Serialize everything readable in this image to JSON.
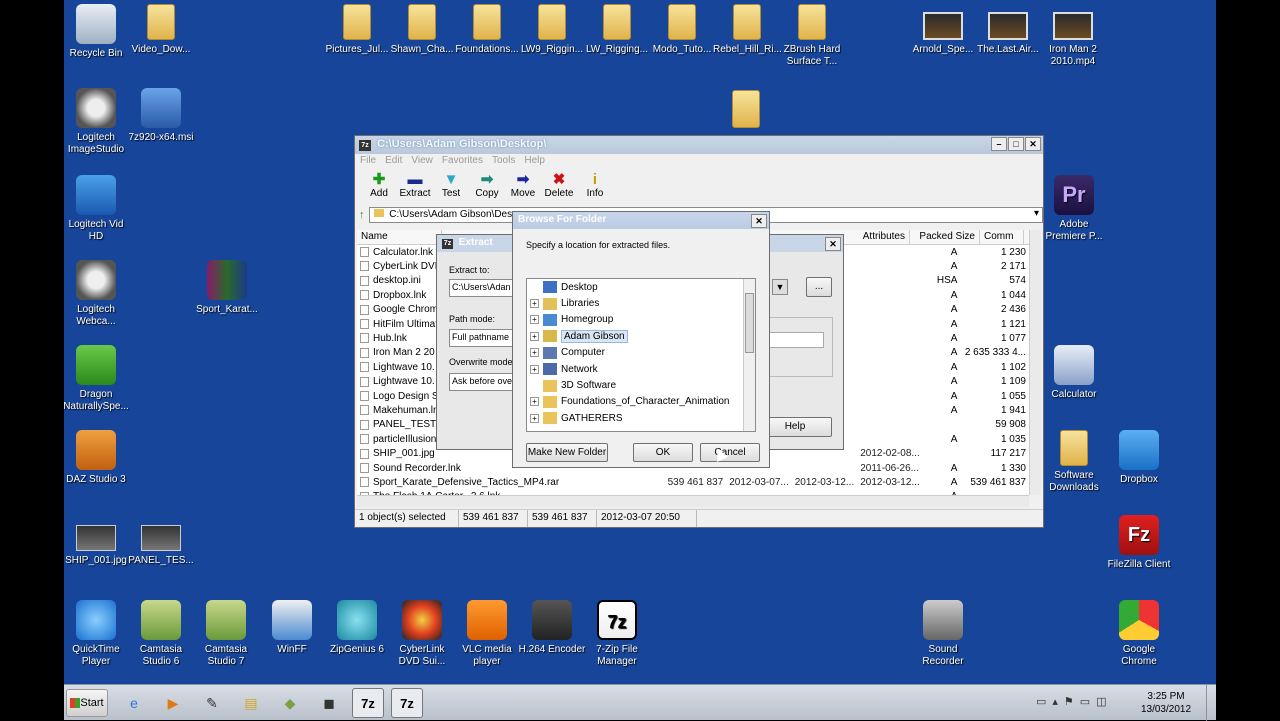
{
  "desktop": {
    "icons_top": [
      {
        "label": "Recycle Bin",
        "icon": "recycle-bin-icon"
      },
      {
        "label": "Video_Dow...",
        "icon": "folder-icon"
      },
      {
        "label": "Pictures_Jul...",
        "icon": "folder-icon"
      },
      {
        "label": "Shawn_Cha...",
        "icon": "folder-icon"
      },
      {
        "label": "Foundations...",
        "icon": "folder-icon"
      },
      {
        "label": "LW9_Riggin...",
        "icon": "folder-icon"
      },
      {
        "label": "LW_Rigging...",
        "icon": "folder-icon"
      },
      {
        "label": "Modo_Tuto...",
        "icon": "folder-icon"
      },
      {
        "label": "Rebel_Hill_Ri...",
        "icon": "folder-icon"
      },
      {
        "label": "ZBrush Hard Surface T...",
        "icon": "folder-icon"
      },
      {
        "label": "Arnold_Spe...",
        "icon": "video-icon"
      },
      {
        "label": "The.Last.Air...",
        "icon": "video-icon"
      },
      {
        "label": "Iron Man 2 2010.mp4",
        "icon": "video-icon"
      }
    ],
    "icons_left": [
      {
        "label": "Logitech ImageStudio",
        "icon": "webcam-icon"
      },
      {
        "label": "7z920-x64.msi",
        "icon": "installer-icon"
      },
      {
        "label": "Logitech Vid HD",
        "icon": "logitech-vid-icon"
      },
      {
        "label": "Logitech Webca...",
        "icon": "webcam-icon"
      },
      {
        "label": "Sport_Karat...",
        "icon": "rar-archive-icon"
      },
      {
        "label": "Dragon NaturallySpe...",
        "icon": "dragon-icon"
      },
      {
        "label": "DAZ Studio 3",
        "icon": "daz-studio-icon"
      },
      {
        "label": "SHIP_001.jpg",
        "icon": "image-file-icon"
      },
      {
        "label": "PANEL_TES...",
        "icon": "image-file-icon"
      }
    ],
    "icons_right": [
      {
        "label": "Adobe Premiere P...",
        "icon": "premiere-icon"
      },
      {
        "label": "Calculator",
        "icon": "calculator-icon"
      },
      {
        "label": "Software Downloads",
        "icon": "folder-icon"
      },
      {
        "label": "Dropbox",
        "icon": "dropbox-icon"
      },
      {
        "label": "FileZilla Client",
        "icon": "filezilla-icon"
      }
    ],
    "icons_bottom": [
      {
        "label": "QuickTime Player",
        "icon": "quicktime-icon"
      },
      {
        "label": "Camtasia Studio 6",
        "icon": "camtasia-icon"
      },
      {
        "label": "Camtasia Studio 7",
        "icon": "camtasia-icon"
      },
      {
        "label": "WinFF",
        "icon": "winff-icon"
      },
      {
        "label": "ZipGenius 6",
        "icon": "zipgenius-icon"
      },
      {
        "label": "CyberLink DVD Sui...",
        "icon": "cyberlink-icon"
      },
      {
        "label": "VLC media player",
        "icon": "vlc-icon"
      },
      {
        "label": "H.264 Encoder",
        "icon": "h264-icon"
      },
      {
        "label": "7-Zip File Manager",
        "icon": "7zip-icon"
      },
      {
        "label": "Sound Recorder",
        "icon": "microphone-icon"
      },
      {
        "label": "Google Chrome",
        "icon": "chrome-icon"
      }
    ]
  },
  "fm": {
    "title": "C:\\Users\\Adam Gibson\\Desktop\\",
    "menu": [
      "File",
      "Edit",
      "View",
      "Favorites",
      "Tools",
      "Help"
    ],
    "toolbar": [
      {
        "label": "Add",
        "icon": "add-icon",
        "color": "#1a9a1a",
        "glyph": "✚"
      },
      {
        "label": "Extract",
        "icon": "extract-icon",
        "color": "#1c2a8a",
        "glyph": "▬"
      },
      {
        "label": "Test",
        "icon": "test-icon",
        "color": "#2aa8c8",
        "glyph": "▼"
      },
      {
        "label": "Copy",
        "icon": "copy-icon",
        "color": "#1d8a7a",
        "glyph": "➡"
      },
      {
        "label": "Move",
        "icon": "move-icon",
        "color": "#1a2a9a",
        "glyph": "➡"
      },
      {
        "label": "Delete",
        "icon": "delete-icon",
        "color": "#d01010",
        "glyph": "✖"
      },
      {
        "label": "Info",
        "icon": "info-icon",
        "color": "#c8a000",
        "glyph": "i"
      }
    ],
    "path": "C:\\Users\\Adam Gibson\\Des",
    "columns": [
      "Name",
      "Attributes",
      "Packed Size",
      "Comm"
    ],
    "files": [
      {
        "name": "Calculator.lnk",
        "attr": "A",
        "packed": "1 230"
      },
      {
        "name": "CyberLink DVD",
        "attr": "A",
        "packed": "2 171"
      },
      {
        "name": "desktop.ini",
        "attr": "HSA",
        "packed": "574"
      },
      {
        "name": "Dropbox.lnk",
        "attr": "A",
        "packed": "1 044"
      },
      {
        "name": "Google Chrom",
        "attr": "A",
        "packed": "2 436"
      },
      {
        "name": "HitFilm Ultimat",
        "attr": "A",
        "packed": "1 121"
      },
      {
        "name": "Hub.lnk",
        "attr": "A",
        "packed": "1 077"
      },
      {
        "name": "Iron Man 2 20",
        "attr": "A",
        "packed": "2 635 333 4..."
      },
      {
        "name": "Lightwave 10.",
        "attr": "A",
        "packed": "1 102"
      },
      {
        "name": "Lightwave 10.",
        "attr": "A",
        "packed": "1 109"
      },
      {
        "name": "Logo Design S",
        "attr": "A",
        "packed": "1 055"
      },
      {
        "name": "Makehuman.ln",
        "attr": "A",
        "packed": "1 941"
      },
      {
        "name": "PANEL_TEST.j",
        "attr": "",
        "packed": "59 908"
      },
      {
        "name": "particleIllusion",
        "attr": "A",
        "packed": "1 035"
      },
      {
        "name": "SHIP_001.jpg",
        "attr": "",
        "packed": "117 217"
      },
      {
        "name": "Sound Recorder.lnk",
        "attr": "A",
        "packed": "1 330"
      },
      {
        "name": "Sport_Karate_Defensive_Tactics_MP4.rar",
        "attr": "A",
        "packed": "539 461 837"
      },
      {
        "name": "The.Flash.1A.Carter...2.6.lnk",
        "attr": "A",
        "packed": ""
      }
    ],
    "extra_cols": [
      {
        "size": "",
        "modified": "",
        "created": "",
        "accessed": "2012-02-08..."
      },
      {
        "size": "",
        "modified": "",
        "created": "",
        "accessed": "2011-06-26..."
      },
      {
        "size": "539 461 837",
        "modified": "2012-03-07...",
        "created": "2012-03-12...",
        "accessed": "2012-03-12..."
      }
    ],
    "status": {
      "selected": "1 object(s) selected",
      "size": "539 461 837",
      "packed": "539 461 837",
      "date": "2012-03-07 20:50"
    }
  },
  "extract": {
    "title": "Extract",
    "extract_to_label": "Extract to:",
    "extract_to_value": "C:\\Users\\Adan",
    "browse_label": "...",
    "path_mode_label": "Path mode:",
    "path_mode_value": "Full pathname",
    "overwrite_label": "Overwrite mode",
    "overwrite_value": "Ask before ove",
    "help_label": "Help"
  },
  "browse": {
    "title": "Browse For Folder",
    "instruction": "Specify a location for extracted files.",
    "tree": [
      {
        "label": "Desktop",
        "expander": "",
        "icon": "desktop-icon",
        "color": "#3d6fc4",
        "selected": false
      },
      {
        "label": "Libraries",
        "expander": "+",
        "icon": "libraries-icon",
        "color": "#e3c15a",
        "selected": false
      },
      {
        "label": "Homegroup",
        "expander": "+",
        "icon": "homegroup-icon",
        "color": "#4a8ad0",
        "selected": false
      },
      {
        "label": "Adam Gibson",
        "expander": "+",
        "icon": "user-folder-icon",
        "color": "#d8b84a",
        "selected": true
      },
      {
        "label": "Computer",
        "expander": "+",
        "icon": "computer-icon",
        "color": "#5a7ab0",
        "selected": false
      },
      {
        "label": "Network",
        "expander": "+",
        "icon": "network-icon",
        "color": "#4a6aa8",
        "selected": false
      },
      {
        "label": "3D Software",
        "expander": "",
        "icon": "folder-icon",
        "color": "#e8c45a",
        "selected": false
      },
      {
        "label": "Foundations_of_Character_Animation",
        "expander": "+",
        "icon": "folder-icon",
        "color": "#e8c45a",
        "selected": false
      },
      {
        "label": "GATHERERS",
        "expander": "+",
        "icon": "folder-icon",
        "color": "#e8c45a",
        "selected": false
      }
    ],
    "make_new_folder": "Make New Folder",
    "ok": "OK",
    "cancel": "Cancel"
  },
  "taskbar": {
    "start": "Start",
    "time": "3:25 PM",
    "date": "13/03/2012",
    "items": [
      {
        "icon": "ie-icon",
        "glyph": "e",
        "color": "#2a7ad8"
      },
      {
        "icon": "media-player-icon",
        "glyph": "▶",
        "color": "#e07a10"
      },
      {
        "icon": "pen-tool-icon",
        "glyph": "✎",
        "color": "#333"
      },
      {
        "icon": "explorer-icon",
        "glyph": "▤",
        "color": "#d8a820"
      },
      {
        "icon": "camtasia-icon",
        "glyph": "◆",
        "color": "#7aa040"
      },
      {
        "icon": "clapper-icon",
        "glyph": "◼",
        "color": "#333"
      },
      {
        "icon": "7zip-icon",
        "glyph": "7z",
        "color": "#000"
      },
      {
        "icon": "7zip-icon",
        "glyph": "7z",
        "color": "#000"
      }
    ]
  }
}
